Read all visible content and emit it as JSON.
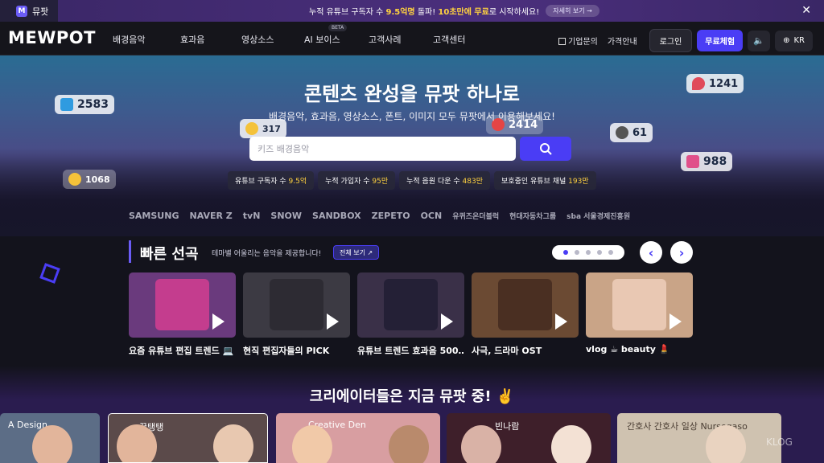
{
  "browser": {
    "tab_title": "뮤팟",
    "tab_favicon": "M"
  },
  "promo": {
    "p1": "누적 유튜브 구독자 수 ",
    "h1": "9.5억명",
    "p2": " 돌파! ",
    "h2": "10초만에 무료",
    "p3": "로 시작하세요!",
    "button": "자세히 보기 →"
  },
  "nav": {
    "logo": "MEWPOT",
    "menu": [
      "배경음악",
      "효과음",
      "영상소스",
      "AI 보이스",
      "고객사례",
      "고객센터"
    ],
    "beta": "BETA",
    "enterprise": "기업문의",
    "pricing": "가격안내",
    "login": "로그인",
    "trial": "무료체험",
    "lang": "KR"
  },
  "hero": {
    "title": "콘텐츠 완성을 뮤팟 하나로",
    "subtitle": "배경음악, 효과음, 영상소스, 폰트, 이미지 모두 뮤팟에서 이용해보세요!",
    "search_placeholder": "키즈 배경음악",
    "stats": [
      {
        "label": "유튜브 구독자 수 ",
        "value": "9.5억"
      },
      {
        "label": "누적 가입자 수 ",
        "value": "95만"
      },
      {
        "label": "누적 음원 다운 수 ",
        "value": "483만"
      },
      {
        "label": "보호중인 유튜브 채널 ",
        "value": "193만"
      }
    ],
    "bubbles": [
      "2583",
      "317",
      "2414",
      "61",
      "1241",
      "988",
      "1068"
    ]
  },
  "partners": [
    "SAMSUNG",
    "NAVER Z",
    "tvN",
    "SNOW",
    "SANDBOX",
    "ZEPETO",
    "OCN",
    "유퀴즈온더블럭",
    "현대자동차그룹",
    "sba 서울경제진흥원"
  ],
  "quick_picks": {
    "title": "빠른 선곡",
    "desc": "테마별 어울리는 음악을 제공합니다!",
    "view_all": "전체 보기",
    "cards": [
      {
        "label": "요즘 유튜브 편집 트렌드 💻",
        "bg": "#6a3a7d",
        "art": "#c43d8e"
      },
      {
        "label": "현직 편집자들의 PICK",
        "bg": "#3c3a43",
        "art": "#2d2b33"
      },
      {
        "label": "유튜브 트렌드 효과음 500…",
        "bg": "#3a3048",
        "art": "#242036"
      },
      {
        "label": "사극, 드라마 OST",
        "bg": "#6b4a33",
        "art": "#4a2f22"
      },
      {
        "label": "vlog ☕ beauty 💄",
        "bg": "#c9a487",
        "art": "#e9c8b3"
      }
    ]
  },
  "creators": {
    "title": "크리에이터들은 지금 뮤팟 중! ✌️",
    "strips": [
      {
        "label": "A Design",
        "bg": "#5c6d86"
      },
      {
        "label": "꿀탱탱",
        "bg": "#5b4a4a"
      },
      {
        "label": "Creative Den",
        "bg": "#d89ea1"
      },
      {
        "label": "빈나람",
        "bg": "#3e1f2a"
      },
      {
        "label": "간호사 간호사 일상 Nursegaso",
        "bg": "#cfc2b0"
      }
    ],
    "watermark": "KLOG"
  },
  "colors": {
    "accent": "#4a3df5",
    "highlight": "#ffd23f"
  }
}
